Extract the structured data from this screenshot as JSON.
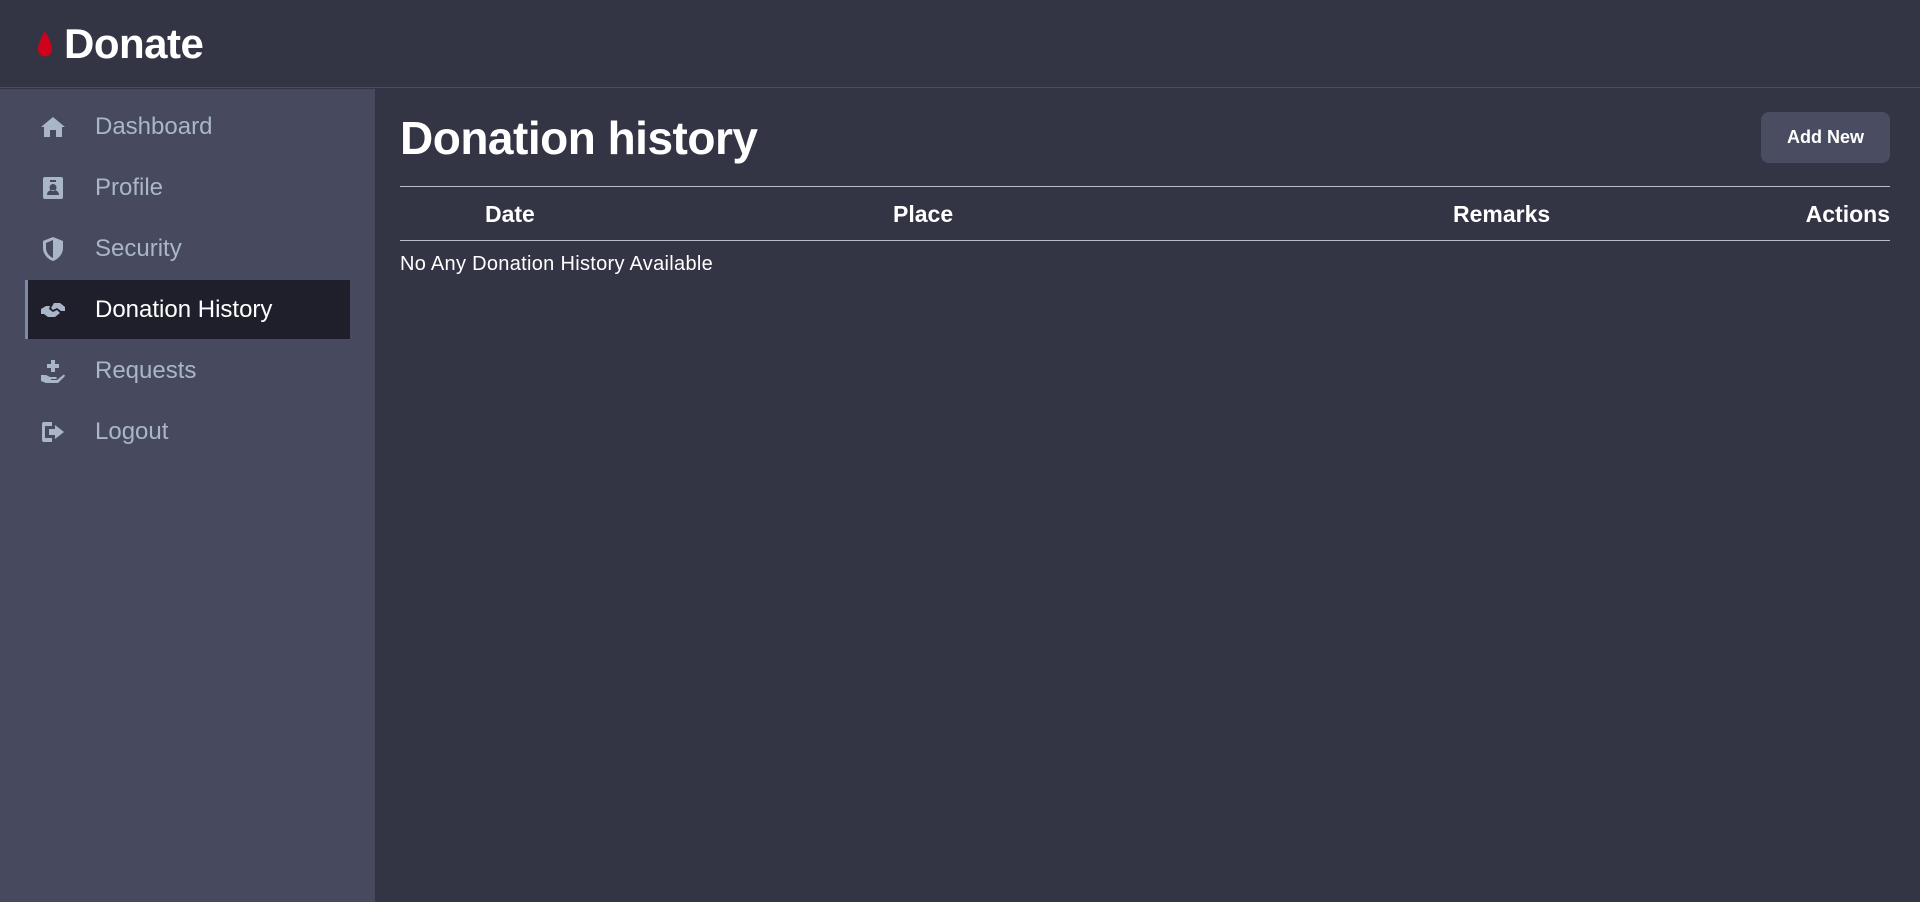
{
  "app": {
    "brand": "Donate",
    "brand_color": "#d0021b"
  },
  "sidebar": {
    "items": [
      {
        "label": "Dashboard",
        "icon": "home-icon",
        "active": false
      },
      {
        "label": "Profile",
        "icon": "id-badge-icon",
        "active": false
      },
      {
        "label": "Security",
        "icon": "shield-icon",
        "active": false
      },
      {
        "label": "Donation History",
        "icon": "hands-helping-icon",
        "active": true
      },
      {
        "label": "Requests",
        "icon": "hand-holding-medical-icon",
        "active": false
      },
      {
        "label": "Logout",
        "icon": "sign-out-icon",
        "active": false
      }
    ]
  },
  "main": {
    "title": "Donation history",
    "add_button_label": "Add New",
    "table": {
      "columns": [
        "Date",
        "Place",
        "Remarks",
        "Actions"
      ],
      "rows": [],
      "empty_message": "No Any Donation History Available"
    }
  }
}
